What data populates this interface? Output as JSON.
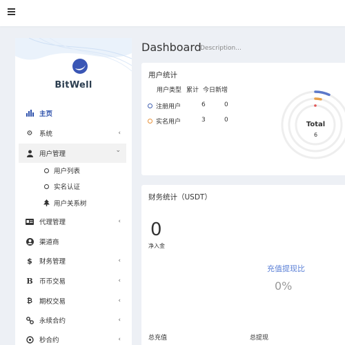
{
  "topbar": {
    "menu_icon": "hamburger-icon"
  },
  "brand": {
    "name": "BitWell",
    "logo_icon": "bitwell-logo-icon",
    "accent": "#2a4eaa"
  },
  "sidebar": {
    "items": [
      {
        "label": "主页",
        "icon": "bar-chart-icon",
        "active": true
      },
      {
        "label": "系统",
        "icon": "gear-icon",
        "arrow": "‹"
      },
      {
        "label": "用户管理",
        "icon": "users-icon",
        "arrow": "⌄",
        "open": true
      },
      {
        "label": "代理管理",
        "icon": "id-card-icon",
        "arrow": "‹"
      },
      {
        "label": "渠道商",
        "icon": "user-circle-icon"
      },
      {
        "label": "财务管理",
        "icon": "dollar-icon",
        "arrow": "‹"
      },
      {
        "label": "币币交易",
        "icon": "bitcoin-b-icon",
        "arrow": "‹"
      },
      {
        "label": "期权交易",
        "icon": "bitcoin-icon",
        "arrow": "‹"
      },
      {
        "label": "永续合约",
        "icon": "link-icon",
        "arrow": "‹"
      },
      {
        "label": "秒合约",
        "icon": "target-icon",
        "arrow": "‹"
      }
    ],
    "sub_items": [
      {
        "label": "用户列表",
        "icon": "circle-icon"
      },
      {
        "label": "实名认证",
        "icon": "circle-icon"
      },
      {
        "label": "用户关系树",
        "icon": "tree-icon"
      }
    ]
  },
  "page": {
    "title": "Dashboard",
    "description": "Description..."
  },
  "user_stats": {
    "title": "用户统计",
    "headers": [
      "用户类型",
      "累计",
      "今日新增"
    ],
    "rows": [
      {
        "type": "注册用户",
        "total": "6",
        "today": "0",
        "color": "#3f5fb0"
      },
      {
        "type": "实名用户",
        "total": "3",
        "today": "0",
        "color": "#e8913a"
      }
    ],
    "total_label": "Total",
    "total_value": "6"
  },
  "finance": {
    "title": "财务统计（USDT）",
    "net_value": "0",
    "net_label": "净入金",
    "ratio_label": "充值提现比",
    "ratio_value": "0%",
    "deposit_total_label": "总充值",
    "withdraw_total_label": "总提现"
  }
}
